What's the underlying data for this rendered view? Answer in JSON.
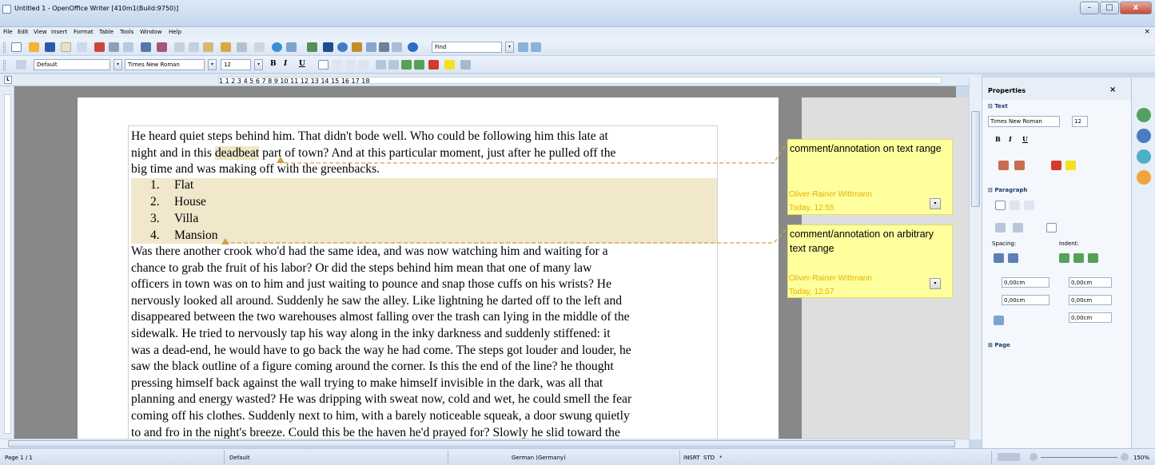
{
  "window": {
    "title": "Untitled 1 - OpenOffice Writer [410m1(Build:9750)]",
    "minimize": "–",
    "maximize": "□",
    "close": "x"
  },
  "menubar": {
    "items": [
      "File",
      "Edit",
      "View",
      "Insert",
      "Format",
      "Table",
      "Tools",
      "Window",
      "Help"
    ],
    "close_doc": "×"
  },
  "toolbar": {
    "find_placeholder": "Find",
    "paragraph_style": "Default",
    "font_name": "Times New Roman",
    "font_size": "12",
    "bold": "B",
    "italic": "I",
    "underline": "U"
  },
  "ruler": {
    "corner": "L",
    "marks": [
      "1",
      "1",
      "2",
      "3",
      "4",
      "5",
      "6",
      "7",
      "8",
      "9",
      "10",
      "11",
      "12",
      "13",
      "14",
      "15",
      "16",
      "17",
      "18"
    ]
  },
  "document": {
    "lines_before": [
      "He heard quiet steps behind him. That didn't bode well. Who could be following him this late at",
      "big time and was making off with the greenbacks."
    ],
    "line2_prefix": "night and in this ",
    "line2_highlight": "deadbeat",
    "line2_suffix": " part of town? And at this particular moment, just after he pulled off the",
    "list": [
      "Flat",
      "House",
      "Villa",
      "Mansion"
    ],
    "list_numbers": [
      "1.",
      "2.",
      "3.",
      "4."
    ],
    "lines_after": [
      "Was there another crook who'd had the same idea, and was now watching him and waiting for a",
      "chance to grab the fruit of his labor? Or did the steps behind him mean that one of many law",
      "officers in town was on to him and just waiting to pounce and snap those cuffs on his wrists? He",
      "nervously looked all around. Suddenly he saw the alley. Like lightning he darted off to the left and",
      "disappeared between the two warehouses almost falling over the trash can lying in the middle of the",
      "sidewalk. He tried to nervously tap his way along in the inky darkness and suddenly stiffened: it",
      "was a dead-end, he would have to go back the way he had come. The steps got louder and louder, he",
      "saw the black outline of a figure coming around the corner. Is this the end of the line? he thought",
      "pressing himself back against the wall trying to make himself invisible in the dark, was all that",
      "planning and energy wasted? He was dripping with sweat now, cold and wet, he could smell the fear",
      "coming off his clothes. Suddenly next to him, with a barely noticeable squeak, a door swung quietly",
      "to and fro in the night's breeze. Could this be the haven he'd prayed for? Slowly he slid toward the"
    ]
  },
  "comments": [
    {
      "text": "comment/annotation on text range",
      "author": "Oliver-Rainer Wittmann",
      "time": "Today, 12:55"
    },
    {
      "text": "comment/annotation on arbitrary text range",
      "author": "Oliver-Rainer Wittmann",
      "time": "Today, 12:57"
    }
  ],
  "sidebar": {
    "title": "Properties",
    "close": "×",
    "text_section": "Text",
    "font_name": "Times New Roman",
    "font_size": "12",
    "bold": "B",
    "italic": "I",
    "underline": "U",
    "paragraph_section": "Paragraph",
    "spacing_label": "Spacing:",
    "indent_label": "Indent:",
    "above_spacing": "0,00cm",
    "below_spacing": "0,00cm",
    "before_indent": "0,00cm",
    "after_indent": "0,00cm",
    "first_line_indent": "0,00cm",
    "page_section": "Page"
  },
  "statusbar": {
    "page": "Page 1 / 1",
    "style": "Default",
    "language": "German (Germany)",
    "insert_mode": "INSRT",
    "selection_mode": "STD",
    "modified": "*",
    "zoom": "150%"
  },
  "colors": {
    "comment_bg": "#ffff9e",
    "comment_author": "#e0b200",
    "highlight": "#efe6c6",
    "anchor_line": "#d2a04b"
  }
}
